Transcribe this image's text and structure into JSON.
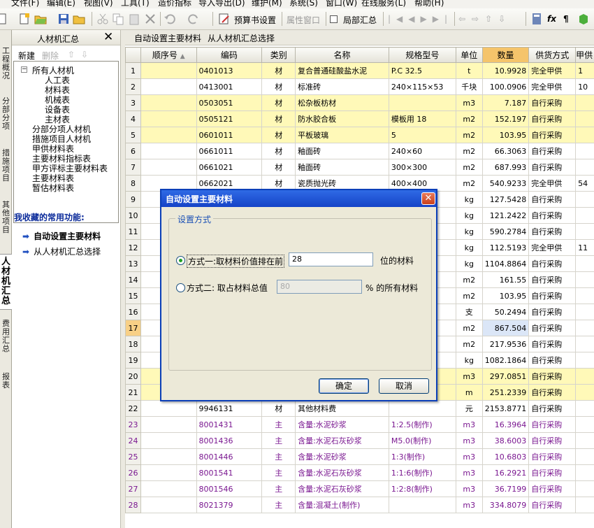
{
  "menu": [
    "文件(F)",
    "编辑(E)",
    "视图(V)",
    "工具(T)",
    "造价指标",
    "导入导出(D)",
    "维护(M)",
    "系统(S)",
    "窗口(W)",
    "在线服务(L)",
    "帮助(H)"
  ],
  "toolbar": {
    "budget_settings": "预算书设置",
    "attr_window": "属性窗口",
    "partial_summary": "局部汇总"
  },
  "vtabs": [
    "工程概况",
    "分部分项",
    "措施项目",
    "其他项目",
    "人材机汇总",
    "费用汇总",
    "报表"
  ],
  "left_panel": {
    "title": "人材机汇总",
    "new": "新建",
    "delete": "删除",
    "tree": [
      "所有人材机",
      "人工表",
      "材料表",
      "机械表",
      "设备表",
      "主材表",
      "分部分项人材机",
      "措施项目人材机",
      "甲供材料表",
      "主要材料指标表",
      "甲方评标主要材料表",
      "主要材料表",
      "暂估材料表"
    ],
    "favorites_title": "我收藏的常用功能:",
    "favorites": [
      "自动设置主要材料",
      "从人材机汇总选择"
    ]
  },
  "tabs": [
    "自动设置主要材料",
    "从人材机汇总选择"
  ],
  "columns": [
    "顺序号",
    "编码",
    "类别",
    "名称",
    "规格型号",
    "单位",
    "数量",
    "供货方式",
    "甲供"
  ],
  "rows": [
    {
      "n": "1",
      "code": "0401013",
      "cat": "材",
      "name": "复合普通硅酸盐水泥",
      "spec": "P.C  32.5",
      "unit": "t",
      "qty": "10.9928",
      "supply": "完全甲供",
      "extra": "1"
    },
    {
      "n": "2",
      "code": "0413001",
      "cat": "材",
      "name": "标准砖",
      "spec": "240×115×53",
      "unit": "千块",
      "qty": "100.0906",
      "supply": "完全甲供",
      "extra": "10"
    },
    {
      "n": "3",
      "code": "0503051",
      "cat": "材",
      "name": "松杂板枋材",
      "spec": "",
      "unit": "m3",
      "qty": "7.187",
      "supply": "自行采购",
      "extra": ""
    },
    {
      "n": "4",
      "code": "0505121",
      "cat": "材",
      "name": "防水胶合板",
      "spec": "模板用 18",
      "unit": "m2",
      "qty": "152.197",
      "supply": "自行采购",
      "extra": ""
    },
    {
      "n": "5",
      "code": "0601011",
      "cat": "材",
      "name": "平板玻璃",
      "spec": "5",
      "unit": "m2",
      "qty": "103.95",
      "supply": "自行采购",
      "extra": ""
    },
    {
      "n": "6",
      "code": "0661011",
      "cat": "材",
      "name": "釉面砖",
      "spec": "240×60",
      "unit": "m2",
      "qty": "66.3063",
      "supply": "自行采购",
      "extra": ""
    },
    {
      "n": "7",
      "code": "0661021",
      "cat": "材",
      "name": "釉面砖",
      "spec": "300×300",
      "unit": "m2",
      "qty": "687.993",
      "supply": "自行采购",
      "extra": ""
    },
    {
      "n": "8",
      "code": "0662021",
      "cat": "材",
      "name": "瓷质抛光砖",
      "spec": "400×400",
      "unit": "m2",
      "qty": "540.9233",
      "supply": "完全甲供",
      "extra": "54"
    },
    {
      "n": "9",
      "code": "",
      "cat": "",
      "name": "",
      "spec": "",
      "unit": "kg",
      "qty": "127.5428",
      "supply": "自行采购",
      "extra": ""
    },
    {
      "n": "10",
      "code": "",
      "cat": "",
      "name": "",
      "spec": "",
      "unit": "kg",
      "qty": "121.2422",
      "supply": "自行采购",
      "extra": ""
    },
    {
      "n": "11",
      "code": "",
      "cat": "",
      "name": "",
      "spec": "",
      "unit": "kg",
      "qty": "590.2784",
      "supply": "自行采购",
      "extra": ""
    },
    {
      "n": "12",
      "code": "",
      "cat": "",
      "name": "",
      "spec": "",
      "unit": "kg",
      "qty": "112.5193",
      "supply": "完全甲供",
      "extra": "11"
    },
    {
      "n": "13",
      "code": "",
      "cat": "",
      "name": "",
      "spec": "",
      "unit": "kg",
      "qty": "1104.8864",
      "supply": "自行采购",
      "extra": ""
    },
    {
      "n": "14",
      "code": "",
      "cat": "",
      "name": "",
      "spec": "",
      "unit": "m2",
      "qty": "161.55",
      "supply": "自行采购",
      "extra": ""
    },
    {
      "n": "15",
      "code": "",
      "cat": "",
      "name": "",
      "spec": "",
      "unit": "m2",
      "qty": "103.95",
      "supply": "自行采购",
      "extra": ""
    },
    {
      "n": "16",
      "code": "",
      "cat": "",
      "name": "",
      "spec": "",
      "unit": "支",
      "qty": "50.2494",
      "supply": "自行采购",
      "extra": ""
    },
    {
      "n": "17",
      "code": "",
      "cat": "",
      "name": "",
      "spec": "",
      "unit": "m2",
      "qty": "867.504",
      "supply": "自行采购",
      "extra": ""
    },
    {
      "n": "18",
      "code": "",
      "cat": "",
      "name": "",
      "spec": "",
      "unit": "m2",
      "qty": "217.9536",
      "supply": "自行采购",
      "extra": ""
    },
    {
      "n": "19",
      "code": "",
      "cat": "",
      "name": "",
      "spec": "",
      "unit": "kg",
      "qty": "1082.1864",
      "supply": "自行采购",
      "extra": ""
    },
    {
      "n": "20",
      "code": "",
      "cat": "",
      "name": "",
      "spec": "",
      "unit": "m3",
      "qty": "297.0851",
      "supply": "自行采购",
      "extra": ""
    },
    {
      "n": "21",
      "code": "",
      "cat": "",
      "name": "",
      "spec": "",
      "unit": "m",
      "qty": "251.2339",
      "supply": "自行采购",
      "extra": ""
    },
    {
      "n": "22",
      "code": "9946131",
      "cat": "材",
      "name": "其他材料费",
      "spec": "",
      "unit": "元",
      "qty": "2153.8771",
      "supply": "自行采购",
      "extra": ""
    },
    {
      "n": "23",
      "code": "8001431",
      "cat": "主",
      "name": "含量:水泥砂浆",
      "spec": "1:2.5(制作)",
      "unit": "m3",
      "qty": "16.3964",
      "supply": "自行采购",
      "extra": ""
    },
    {
      "n": "24",
      "code": "8001436",
      "cat": "主",
      "name": "含量:水泥石灰砂浆",
      "spec": "M5.0(制作)",
      "unit": "m3",
      "qty": "38.6003",
      "supply": "自行采购",
      "extra": ""
    },
    {
      "n": "25",
      "code": "8001446",
      "cat": "主",
      "name": "含量:水泥砂浆",
      "spec": "1:3(制作)",
      "unit": "m3",
      "qty": "10.6803",
      "supply": "自行采购",
      "extra": ""
    },
    {
      "n": "26",
      "code": "8001541",
      "cat": "主",
      "name": "含量:水泥石灰砂浆",
      "spec": "1:1:6(制作)",
      "unit": "m3",
      "qty": "16.2921",
      "supply": "自行采购",
      "extra": ""
    },
    {
      "n": "27",
      "code": "8001546",
      "cat": "主",
      "name": "含量:水泥石灰砂浆",
      "spec": "1:2:8(制作)",
      "unit": "m3",
      "qty": "36.7199",
      "supply": "自行采购",
      "extra": ""
    },
    {
      "n": "28",
      "code": "8021379",
      "cat": "主",
      "name": "含量:混凝土(制作)",
      "spec": "",
      "unit": "m3",
      "qty": "334.8079",
      "supply": "自行采购",
      "extra": ""
    }
  ],
  "dialog": {
    "title": "自动设置主要材料",
    "group": "设置方式",
    "opt1_label": "方式一:取材料价值排在前",
    "opt1_value": "28",
    "opt1_suffix": "位的材料",
    "opt2_label": "方式二: 取占材料总值",
    "opt2_value": "80",
    "opt2_suffix": "% 的所有材料",
    "ok": "确定",
    "cancel": "取消"
  }
}
